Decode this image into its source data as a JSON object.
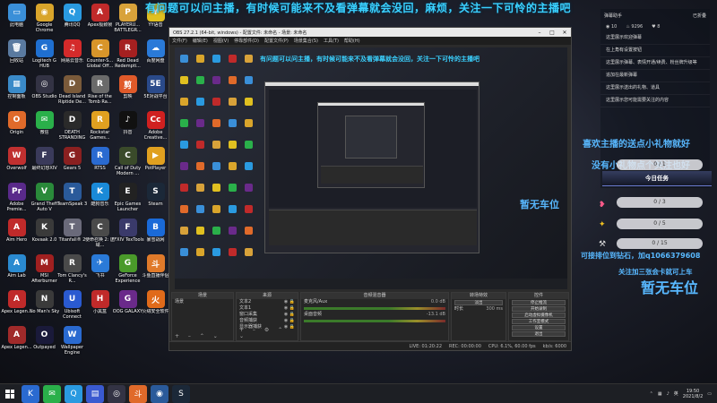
{
  "danmaku": "有问题可以问主播，有时候可能来不及看弹幕就会没回，麻烦，关注一下可怜的主播吧",
  "desktop_icons": [
    {
      "label": "此电脑",
      "color": "#3a8fd8",
      "glyph": "▭",
      "icon": "computer-icon"
    },
    {
      "label": "Google Chrome",
      "color": "#d9a52b",
      "glyph": "◉",
      "icon": "chrome-icon"
    },
    {
      "label": "腾讯QQ",
      "color": "#2a9ae0",
      "glyph": "Q",
      "icon": "qq-icon"
    },
    {
      "label": "Apex极致帧",
      "color": "#c02a2a",
      "glyph": "A",
      "icon": "apex-icon"
    },
    {
      "label": "PLAYERU... BATTLEGR...",
      "color": "#d8a23a",
      "glyph": "P",
      "icon": "pubg-icon"
    },
    {
      "label": "YY语音",
      "color": "#e0c020",
      "glyph": "Y",
      "icon": "yy-icon"
    },
    {
      "label": "回收站",
      "color": "#5a7aa0",
      "glyph": "🗑",
      "icon": "recycle-bin-icon"
    },
    {
      "label": "Logitech G HUB",
      "color": "#1f6fd0",
      "glyph": "G",
      "icon": "logitech-icon"
    },
    {
      "label": "网易云音乐",
      "color": "#d42a2a",
      "glyph": "♫",
      "icon": "netease-music-icon"
    },
    {
      "label": "Counter-S... Global Off...",
      "color": "#d8952a",
      "glyph": "C",
      "icon": "csgo-icon"
    },
    {
      "label": "Red Dead Redempti...",
      "color": "#a52020",
      "glyph": "R",
      "icon": "rdr-icon"
    },
    {
      "label": "百度网盘",
      "color": "#2a7ad8",
      "glyph": "☁",
      "icon": "baidu-disk-icon"
    },
    {
      "label": "控制面板",
      "color": "#3a8ac8",
      "glyph": "▦",
      "icon": "control-panel-icon"
    },
    {
      "label": "OBS Studio",
      "color": "#333344",
      "glyph": "◎",
      "icon": "obs-icon"
    },
    {
      "label": "Dead Island Riptide De...",
      "color": "#7a5a3a",
      "glyph": "D",
      "icon": "dead-island-icon"
    },
    {
      "label": "Rise of the Tomb Ra...",
      "color": "#6a6a6a",
      "glyph": "R",
      "icon": "tomb-raider-icon"
    },
    {
      "label": "剪映",
      "color": "#e05a2a",
      "glyph": "剪",
      "icon": "jianying-icon"
    },
    {
      "label": "5E对战平台",
      "color": "#2a4a8a",
      "glyph": "5E",
      "icon": "5e-icon"
    },
    {
      "label": "Origin",
      "color": "#e06a2a",
      "glyph": "O",
      "icon": "origin-icon"
    },
    {
      "label": "微信",
      "color": "#2ab04a",
      "glyph": "✉",
      "icon": "wechat-icon"
    },
    {
      "label": "DEATH STRANDING",
      "color": "#2a2a2a",
      "glyph": "D",
      "icon": "death-stranding-icon"
    },
    {
      "label": "Rockstar Games...",
      "color": "#e0a020",
      "glyph": "R",
      "icon": "rockstar-icon"
    },
    {
      "label": "抖音",
      "color": "#111111",
      "glyph": "♪",
      "icon": "douyin-icon"
    },
    {
      "label": "Adobe Creative...",
      "color": "#d02020",
      "glyph": "Cc",
      "icon": "adobe-cc-icon"
    },
    {
      "label": "Overwolf",
      "color": "#c03030",
      "glyph": "W",
      "icon": "overwolf-icon"
    },
    {
      "label": "最终幻想XIV",
      "color": "#3a3a5a",
      "glyph": "F",
      "icon": "ffxiv-icon"
    },
    {
      "label": "Gears 5",
      "color": "#8a2020",
      "glyph": "G",
      "icon": "gears-icon"
    },
    {
      "label": "RTSS",
      "color": "#2a6ad0",
      "glyph": "R",
      "icon": "rtss-icon"
    },
    {
      "label": "Call of Duty Modern ...",
      "color": "#3a4a2a",
      "glyph": "C",
      "icon": "cod-icon"
    },
    {
      "label": "PotPlayer",
      "color": "#e0a020",
      "glyph": "▶",
      "icon": "potplayer-icon"
    },
    {
      "label": "Adobe Premie...",
      "color": "#5a2a8a",
      "glyph": "Pr",
      "icon": "premiere-icon"
    },
    {
      "label": "Grand Theft Auto V",
      "color": "#2a8a3a",
      "glyph": "V",
      "icon": "gta-icon"
    },
    {
      "label": "TeamSpeak 3",
      "color": "#2a5a9a",
      "glyph": "T",
      "icon": "teamspeak-icon"
    },
    {
      "label": "酷狗音乐",
      "color": "#1a8ad8",
      "glyph": "K",
      "icon": "kugou-icon"
    },
    {
      "label": "Epic Games Launcher",
      "color": "#222222",
      "glyph": "E",
      "icon": "epic-icon"
    },
    {
      "label": "Steam",
      "color": "#1b2838",
      "glyph": "S",
      "icon": "steam-icon"
    },
    {
      "label": "Aim Hero",
      "color": "#c02a2a",
      "glyph": "A",
      "icon": "aim-hero-icon"
    },
    {
      "label": "Kovaak 2.0",
      "color": "#3a3a3a",
      "glyph": "K",
      "icon": "kovaak-icon"
    },
    {
      "label": "Titanfall® 2",
      "color": "#6a6a7a",
      "glyph": "T",
      "icon": "titanfall-icon"
    },
    {
      "label": "使命召唤 2: 区域...",
      "color": "#4a4a4a",
      "glyph": "C",
      "icon": "cod-warzone-icon"
    },
    {
      "label": "FFXIV TexTools",
      "color": "#3a3a6a",
      "glyph": "F",
      "icon": "textools-icon"
    },
    {
      "label": "暴雪战网",
      "color": "#1a6ad8",
      "glyph": "B",
      "icon": "battlenet-icon"
    },
    {
      "label": "Aim Lab",
      "color": "#2a8ad0",
      "glyph": "A",
      "icon": "aimlab-icon"
    },
    {
      "label": "MSI Afterburner",
      "color": "#a02020",
      "glyph": "M",
      "icon": "msi-icon"
    },
    {
      "label": "Tom Clancy's R...",
      "color": "#4a4a4a",
      "glyph": "R",
      "icon": "rainbow-six-icon"
    },
    {
      "label": "飞书",
      "color": "#2a7ad8",
      "glyph": "✈",
      "icon": "feishu-icon"
    },
    {
      "label": "GeForce Experience",
      "color": "#4a9a2a",
      "glyph": "G",
      "icon": "geforce-icon"
    },
    {
      "label": "斗鱼直播伴侣",
      "color": "#e07a2a",
      "glyph": "斗",
      "icon": "douyu-icon"
    },
    {
      "label": "Apex Legen...",
      "color": "#c02a2a",
      "glyph": "A",
      "icon": "apex-legends-icon"
    },
    {
      "label": "No Man's Sky",
      "color": "#3a3a3a",
      "glyph": "N",
      "icon": "nms-icon"
    },
    {
      "label": "Ubisoft Connect",
      "color": "#2a5ad0",
      "glyph": "U",
      "icon": "ubisoft-icon"
    },
    {
      "label": "小黑盒",
      "color": "#c02a2a",
      "glyph": "H",
      "icon": "heybox-icon"
    },
    {
      "label": "OOG GALAXY",
      "color": "#6a2a8a",
      "glyph": "G",
      "icon": "gog-icon"
    },
    {
      "label": "火绒安全软件",
      "color": "#e06a1a",
      "glyph": "火",
      "icon": "huorong-icon"
    },
    {
      "label": "Apex Legen...",
      "color": "#a02a2a",
      "glyph": "A",
      "icon": "apex-legends-2-icon"
    },
    {
      "label": "Outpayed",
      "color": "#1a1a3a",
      "glyph": "O",
      "icon": "outpayed-icon"
    },
    {
      "label": "Wallpaper Engine",
      "color": "#2a6ad0",
      "glyph": "W",
      "icon": "wallpaper-engine-icon"
    }
  ],
  "obs": {
    "title": "OBS 27.2.1 (64-bit, windows) - 配置文件: 未命名 - 场景: 未命名",
    "menu": [
      "文件(F)",
      "编辑(E)",
      "视图(V)",
      "停靠部件(D)",
      "配置文件(P)",
      "场景集合(S)",
      "工具(T)",
      "帮助(H)"
    ],
    "preview_danmaku": "有问题可以问主播，有时候可能来不及看弹幕就会没回，关注一下可怜的主播吧",
    "docks": {
      "scenes": {
        "header": "场景",
        "items": [
          "场景"
        ]
      },
      "sources": {
        "header": "来源",
        "items": [
          "文本2",
          "文本1",
          "窗口采集",
          "音频捕获",
          "显示器捕获"
        ]
      },
      "mixer": {
        "header": "音频混音器",
        "tracks": [
          {
            "name": "麦克风/Aux",
            "db": "0.0 dB"
          },
          {
            "name": "桌面音频",
            "db": "-13.1 dB"
          }
        ]
      },
      "transition": {
        "header": "转场特效",
        "type": "淡出",
        "duration_label": "时长",
        "duration": "300 ms"
      },
      "controls": {
        "header": "控件",
        "buttons": [
          "停止推流",
          "开始录制",
          "启动虚拟摄像机",
          "工作室模式",
          "设置",
          "退出"
        ]
      }
    },
    "status": {
      "live": "LIVE: 01:20:22",
      "rec": "REC: 00:00:00",
      "cpu": "CPU: 6.1%, 60.00 fps",
      "kbps": "kb/s: 6000"
    }
  },
  "chat": {
    "header_left": "弹幕助手",
    "header_right": "已折叠",
    "stats": [
      "10",
      "9296",
      "8"
    ],
    "messages": [
      "这里展示欢迎弹幕",
      "在上角有设置按钮",
      "这里展示弹幕、表情开通/续费、粉丝牌升级等",
      "追加在最新弹幕",
      "这里展示送出的礼物、道具",
      "这里展示您可能需要关注的内容"
    ]
  },
  "overlay": {
    "line1": "喜欢主播的送点小礼物就好",
    "line2": "没有小礼物点个关注也好",
    "task_title": "今日任务",
    "bars": [
      "0 / 1",
      "0 / 3",
      "0 / 5",
      "0 / 15"
    ],
    "no_seat": "暂无车位",
    "vip_line": "可接排位到钻石，加q1066379608",
    "sub_line": "关注加三张会卡就可上车",
    "no_seat_big": "暂无车位"
  },
  "taskbar": {
    "clock_time": "19:50",
    "clock_date": "2021/8/2",
    "tray_lang": "英"
  },
  "colors": {
    "accent_cyan": "#3ad1ff",
    "overlay_blue": "#58b8ff"
  }
}
